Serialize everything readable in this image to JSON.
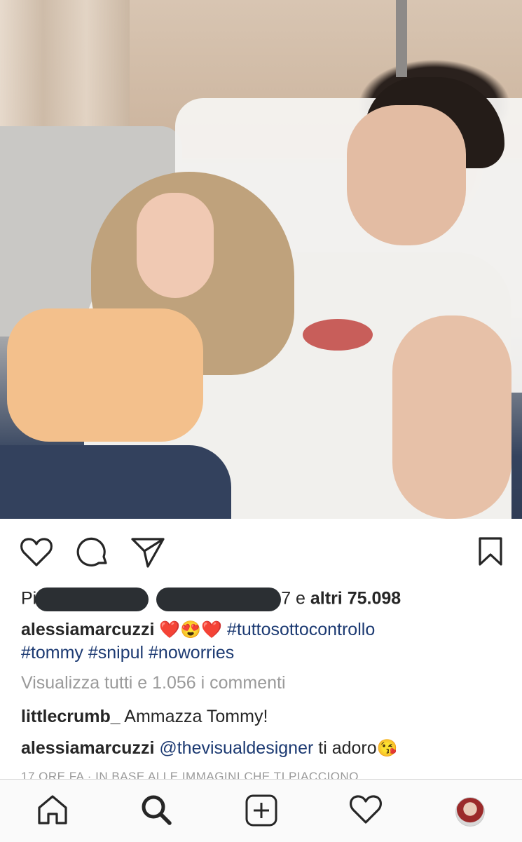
{
  "post": {
    "photo_alt": "",
    "likes": {
      "prefix": "Pi",
      "hidden_end": "7",
      "and": "e",
      "others": "altri 75.098"
    },
    "caption": {
      "username": "alessiamarcuzzi",
      "emoji_1": "❤️",
      "emoji_2": "😍",
      "emoji_3": "❤️",
      "hashtags_line1": "#tuttosottocontrollo",
      "hashtags_line2": "#tommy #snipul #noworries"
    },
    "view_all_comments": "Visualizza tutti e 1.056 i commenti",
    "comments": [
      {
        "username": "littlecrumb_",
        "text": "Ammazza Tommy!"
      },
      {
        "username": "alessiamarcuzzi",
        "mention": "@thevisualdesigner",
        "text": "ti adoro",
        "emoji": "😘"
      }
    ],
    "timestamp": "17 ORE FA · IN BASE ALLE IMMAGINI CHE TI PIACCIONO"
  },
  "actions": {
    "icons": [
      "heart-icon",
      "comment-icon",
      "share-icon",
      "bookmark-icon"
    ]
  },
  "tabbar": {
    "icons": [
      "home-icon",
      "search-icon",
      "add-post-icon",
      "activity-heart-icon",
      "profile-avatar"
    ]
  }
}
